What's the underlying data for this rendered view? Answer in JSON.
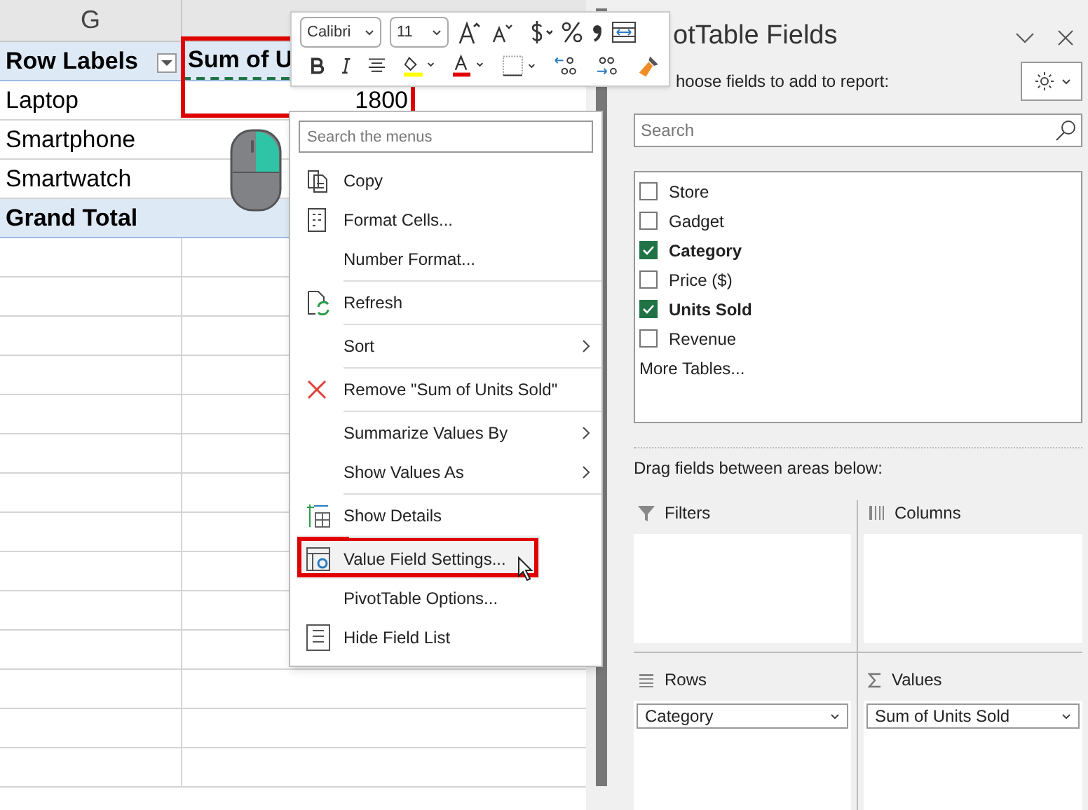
{
  "sheet": {
    "column_header": "G",
    "header_row": [
      "Row Labels",
      "Sum of U"
    ],
    "rows": [
      {
        "label": "Laptop",
        "value": "1800"
      },
      {
        "label": "Smartphone",
        "value": ""
      },
      {
        "label": "Smartwatch",
        "value": ""
      }
    ],
    "total": {
      "label": "Grand Total"
    }
  },
  "mini_toolbar": {
    "font": "Calibri",
    "size": "11"
  },
  "context_menu": {
    "search_placeholder": "Search the menus",
    "items": [
      {
        "label": "Copy",
        "kind": "copy",
        "separator_before": false,
        "submenu": false,
        "highlighted": false
      },
      {
        "label": "Format Cells...",
        "kind": "format",
        "separator_before": false,
        "submenu": false,
        "highlighted": false
      },
      {
        "label": "Number Format...",
        "kind": "plain",
        "separator_before": false,
        "submenu": false,
        "highlighted": false
      },
      {
        "label": "Refresh",
        "kind": "refresh",
        "separator_before": true,
        "submenu": false,
        "highlighted": false
      },
      {
        "label": "Sort",
        "kind": "plain",
        "separator_before": true,
        "submenu": true,
        "highlighted": false
      },
      {
        "label": "Remove \"Sum of Units Sold\"",
        "kind": "remove",
        "separator_before": true,
        "submenu": false,
        "highlighted": false
      },
      {
        "label": "Summarize Values By",
        "kind": "plain",
        "separator_before": true,
        "submenu": true,
        "highlighted": false
      },
      {
        "label": "Show Values As",
        "kind": "plain",
        "separator_before": false,
        "submenu": true,
        "highlighted": false
      },
      {
        "label": "Show Details",
        "kind": "details",
        "separator_before": true,
        "submenu": false,
        "highlighted": false
      },
      {
        "label": "Value Field Settings...",
        "kind": "settings",
        "separator_before": true,
        "submenu": false,
        "highlighted": true
      },
      {
        "label": "PivotTable Options...",
        "kind": "plain",
        "separator_before": false,
        "submenu": false,
        "highlighted": false
      },
      {
        "label": "Hide Field List",
        "kind": "list",
        "separator_before": false,
        "submenu": false,
        "highlighted": false
      }
    ]
  },
  "pane": {
    "title": "otTable Fields",
    "subtitle": "hoose fields to add to report:",
    "search_placeholder": "Search",
    "fields": [
      {
        "label": "Store",
        "checked": false
      },
      {
        "label": "Gadget",
        "checked": false
      },
      {
        "label": "Category",
        "checked": true
      },
      {
        "label": "Price ($)",
        "checked": false
      },
      {
        "label": "Units Sold",
        "checked": true
      },
      {
        "label": "Revenue",
        "checked": false
      }
    ],
    "more_tables": "More Tables...",
    "drag_hint": "Drag fields between areas below:",
    "areas": [
      {
        "kind": "filters",
        "label": "Filters"
      },
      {
        "kind": "columns",
        "label": "Columns"
      },
      {
        "kind": "rows",
        "label": "Rows",
        "fields": [
          "Category"
        ]
      },
      {
        "kind": "values",
        "label": "Values",
        "fields": [
          "Sum of Units Sold"
        ]
      }
    ]
  }
}
